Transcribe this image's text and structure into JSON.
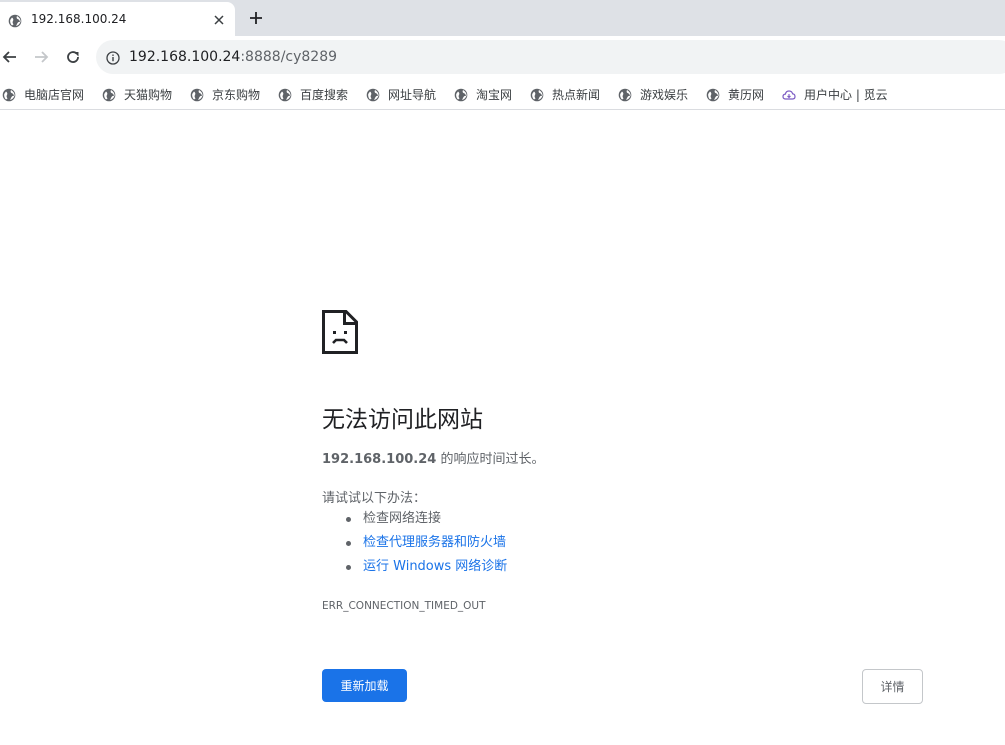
{
  "tab": {
    "title": "192.168.100.24",
    "icon": "globe-icon"
  },
  "toolbar": {
    "url_host": "192.168.100.24",
    "url_rest": ":8888/cy8289"
  },
  "bookmarks": [
    {
      "label": "电脑店官网",
      "icon": "globe-icon"
    },
    {
      "label": "天猫购物",
      "icon": "globe-icon"
    },
    {
      "label": "京东购物",
      "icon": "globe-icon"
    },
    {
      "label": "百度搜索",
      "icon": "globe-icon"
    },
    {
      "label": "网址导航",
      "icon": "globe-icon"
    },
    {
      "label": "淘宝网",
      "icon": "globe-icon"
    },
    {
      "label": "热点新闻",
      "icon": "globe-icon"
    },
    {
      "label": "游戏娱乐",
      "icon": "globe-icon"
    },
    {
      "label": "黄历网",
      "icon": "globe-icon"
    },
    {
      "label": "用户中心 | 觅云",
      "icon": "cloud-icon"
    }
  ],
  "error": {
    "title": "无法访问此网站",
    "host": "192.168.100.24",
    "desc_suffix": " 的响应时间过长。",
    "suggest_intro": "请试试以下办法：",
    "suggestions": [
      {
        "text": "检查网络连接",
        "link": false
      },
      {
        "text": "检查代理服务器和防火墙",
        "link": true
      },
      {
        "text": "运行 Windows 网络诊断",
        "link": true
      }
    ],
    "code": "ERR_CONNECTION_TIMED_OUT",
    "reload_label": "重新加载",
    "details_label": "详情"
  },
  "colors": {
    "accent": "#1a73e8",
    "tabstrip": "#dee1e6",
    "omnibox": "#f1f3f4"
  }
}
